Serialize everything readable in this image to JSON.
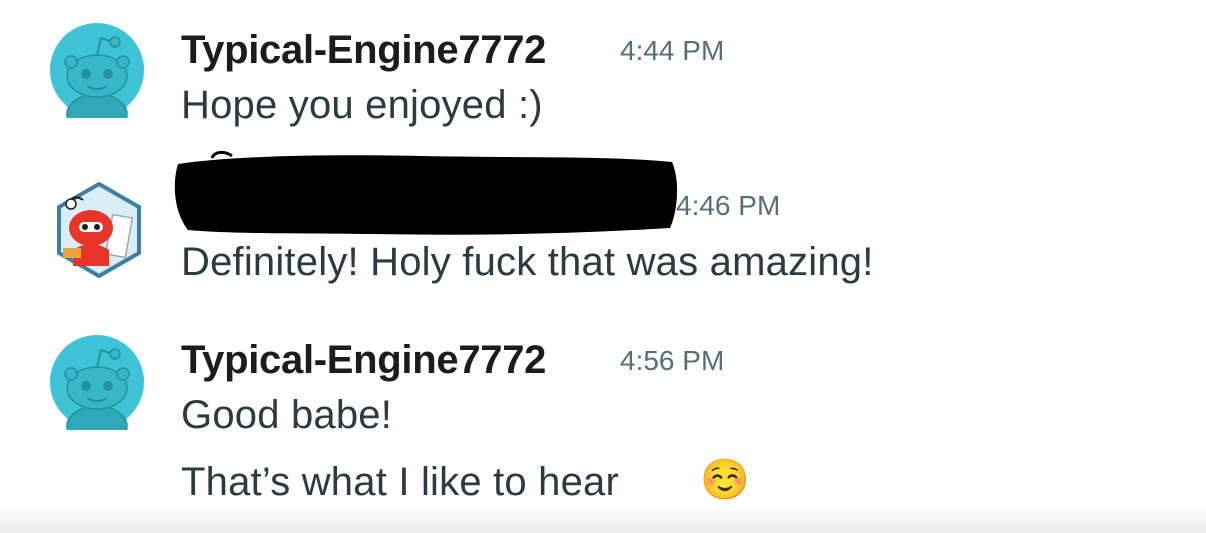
{
  "messages": [
    {
      "username": "Typical-Engine7772",
      "time": "4:44 PM",
      "lines": [
        "Hope you enjoyed :)"
      ]
    },
    {
      "username": "",
      "time": "4:46 PM",
      "lines": [
        "Definitely! Holy fuck that was amazing!"
      ]
    },
    {
      "username": "Typical-Engine7772",
      "time": "4:56 PM",
      "lines": [
        "Good babe!",
        "That’s what I like to hear"
      ],
      "emoji": "☺️"
    }
  ],
  "colors": {
    "avatar_teal": "#3ec4d6",
    "username": "#1c1c1c",
    "timestamp": "#576f76",
    "message_text": "#2a3c42",
    "redaction": "#000000"
  },
  "icons": {
    "avatar_default": "snoo-avatar-icon",
    "avatar_custom": "custom-snoo-avatar-icon"
  }
}
